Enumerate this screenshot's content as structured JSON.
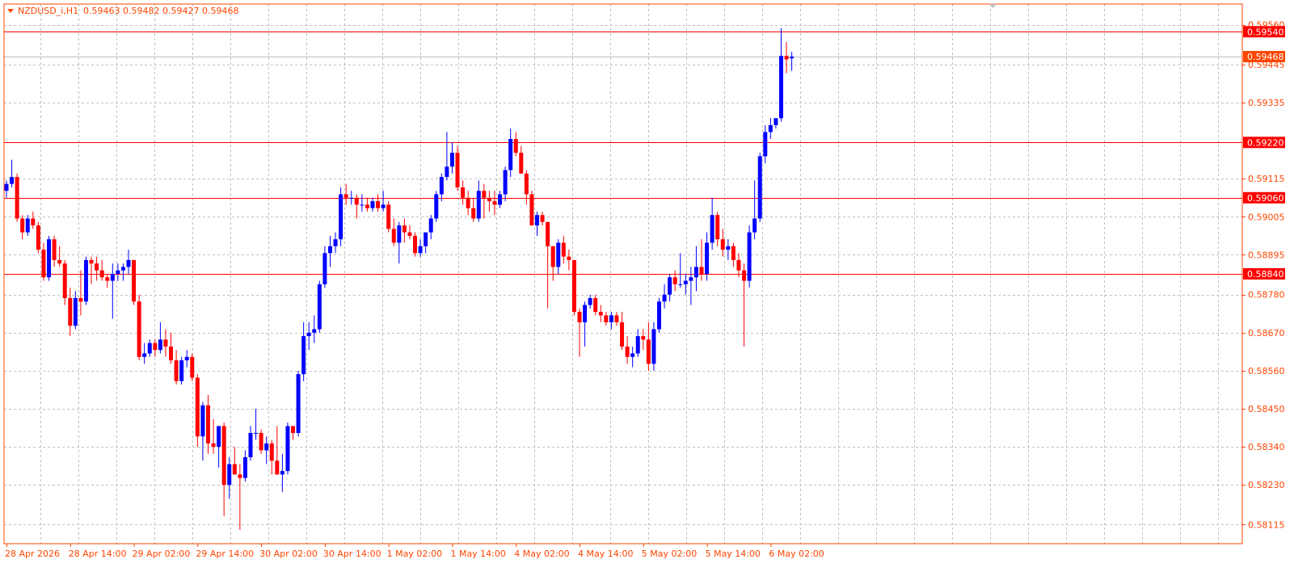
{
  "header": {
    "symbol": "NZDUSD_i,H1",
    "ohlc": "0.59463 0.59482 0.59427 0.59468"
  },
  "colors": {
    "background": "#ffffff",
    "frame": "#ff4500",
    "grid": "#c0c0c0",
    "bull": "#0000ff",
    "bear": "#ff0000",
    "level_line": "#ff0000",
    "bid_line": "#c0c0c0",
    "bid_tag": "#ff4500"
  },
  "chart_data": {
    "type": "candlestick",
    "timeframe": "H1",
    "ylim": [
      0.5806,
      0.5962
    ],
    "grid": true,
    "y_ticks": [
      "0.59560",
      "0.59445",
      "0.59335",
      "0.59115",
      "0.59005",
      "0.58895",
      "0.58780",
      "0.58670",
      "0.58560",
      "0.58450",
      "0.58340",
      "0.58230",
      "0.58115"
    ],
    "y_tick_values": [
      0.5956,
      0.59445,
      0.59335,
      0.59115,
      0.59005,
      0.58895,
      0.5878,
      0.5867,
      0.5856,
      0.5845,
      0.5834,
      0.5823,
      0.58115
    ],
    "x_labels": [
      "28 Apr 2026",
      "28 Apr 14:00",
      "29 Apr 02:00",
      "29 Apr 14:00",
      "30 Apr 02:00",
      "30 Apr 14:00",
      "1 May 02:00",
      "1 May 14:00",
      "4 May 02:00",
      "4 May 14:00",
      "5 May 02:00",
      "5 May 14:00",
      "6 May 02:00"
    ],
    "x_label_bars": [
      0,
      12,
      24,
      36,
      48,
      60,
      72,
      84,
      96,
      108,
      120,
      132,
      144
    ],
    "levels": [
      {
        "label": "0.59540",
        "value": 0.5954
      },
      {
        "label": "0.59220",
        "value": 0.5922
      },
      {
        "label": "0.59060",
        "value": 0.5906
      },
      {
        "label": "0.58840",
        "value": 0.5884
      }
    ],
    "bid": {
      "label": "0.59468",
      "value": 0.59468
    },
    "candles": [
      [
        0.5908,
        0.5911,
        0.5906,
        0.591
      ],
      [
        0.591,
        0.5917,
        0.5909,
        0.5912
      ],
      [
        0.5912,
        0.5913,
        0.5899,
        0.59
      ],
      [
        0.59,
        0.5901,
        0.5894,
        0.5896
      ],
      [
        0.5896,
        0.5901,
        0.5895,
        0.59
      ],
      [
        0.59,
        0.5902,
        0.5897,
        0.5898
      ],
      [
        0.5898,
        0.5899,
        0.589,
        0.5891
      ],
      [
        0.5891,
        0.5893,
        0.5882,
        0.5883
      ],
      [
        0.5883,
        0.5895,
        0.5882,
        0.5894
      ],
      [
        0.5894,
        0.5895,
        0.5886,
        0.5888
      ],
      [
        0.5888,
        0.5892,
        0.5886,
        0.5887
      ],
      [
        0.5887,
        0.5888,
        0.5875,
        0.5877
      ],
      [
        0.5877,
        0.588,
        0.5866,
        0.5869
      ],
      [
        0.5869,
        0.5879,
        0.5868,
        0.5877
      ],
      [
        0.5877,
        0.5885,
        0.5872,
        0.5876
      ],
      [
        0.5876,
        0.5889,
        0.5875,
        0.5888
      ],
      [
        0.5888,
        0.5889,
        0.5881,
        0.5887
      ],
      [
        0.5887,
        0.5889,
        0.5882,
        0.5885
      ],
      [
        0.5885,
        0.5888,
        0.5882,
        0.5883
      ],
      [
        0.5883,
        0.5884,
        0.588,
        0.5882
      ],
      [
        0.5882,
        0.5887,
        0.5871,
        0.5884
      ],
      [
        0.5884,
        0.5887,
        0.5882,
        0.5885
      ],
      [
        0.5885,
        0.5887,
        0.5882,
        0.5886
      ],
      [
        0.5886,
        0.5891,
        0.5884,
        0.5888
      ],
      [
        0.5888,
        0.5888,
        0.5875,
        0.5876
      ],
      [
        0.5876,
        0.5878,
        0.5859,
        0.586
      ],
      [
        0.586,
        0.5864,
        0.5858,
        0.5861
      ],
      [
        0.5861,
        0.5865,
        0.586,
        0.5864
      ],
      [
        0.5864,
        0.5865,
        0.586,
        0.5862
      ],
      [
        0.5862,
        0.587,
        0.5861,
        0.5865
      ],
      [
        0.5865,
        0.5868,
        0.586,
        0.5863
      ],
      [
        0.5863,
        0.5867,
        0.5858,
        0.5859
      ],
      [
        0.5859,
        0.5862,
        0.5852,
        0.5853
      ],
      [
        0.5853,
        0.586,
        0.5852,
        0.5859
      ],
      [
        0.5859,
        0.5862,
        0.5857,
        0.586
      ],
      [
        0.586,
        0.5861,
        0.5853,
        0.5854
      ],
      [
        0.5854,
        0.5855,
        0.5834,
        0.5837
      ],
      [
        0.5837,
        0.5847,
        0.583,
        0.5846
      ],
      [
        0.5846,
        0.5849,
        0.5832,
        0.5835
      ],
      [
        0.5835,
        0.5842,
        0.5832,
        0.5834
      ],
      [
        0.5834,
        0.584,
        0.5828,
        0.584
      ],
      [
        0.584,
        0.5841,
        0.5814,
        0.5823
      ],
      [
        0.5823,
        0.5831,
        0.5819,
        0.5829
      ],
      [
        0.5829,
        0.5834,
        0.5826,
        0.5826
      ],
      [
        0.5826,
        0.5829,
        0.581,
        0.5825
      ],
      [
        0.5825,
        0.5833,
        0.5824,
        0.5831
      ],
      [
        0.5831,
        0.584,
        0.583,
        0.5838
      ],
      [
        0.5838,
        0.5845,
        0.5836,
        0.5838
      ],
      [
        0.5838,
        0.5839,
        0.5832,
        0.5833
      ],
      [
        0.5833,
        0.5837,
        0.5829,
        0.5835
      ],
      [
        0.5835,
        0.5836,
        0.5826,
        0.583
      ],
      [
        0.583,
        0.584,
        0.5826,
        0.5826
      ],
      [
        0.5826,
        0.5832,
        0.5821,
        0.5827
      ],
      [
        0.5827,
        0.5841,
        0.5826,
        0.584
      ],
      [
        0.584,
        0.584,
        0.5836,
        0.5838
      ],
      [
        0.5838,
        0.5856,
        0.5837,
        0.5855
      ],
      [
        0.5855,
        0.587,
        0.5853,
        0.5866
      ],
      [
        0.5866,
        0.587,
        0.5862,
        0.5867
      ],
      [
        0.5867,
        0.5872,
        0.5864,
        0.5868
      ],
      [
        0.5868,
        0.5882,
        0.5867,
        0.5881
      ],
      [
        0.5881,
        0.5892,
        0.588,
        0.589
      ],
      [
        0.589,
        0.5895,
        0.5886,
        0.5892
      ],
      [
        0.5892,
        0.5896,
        0.589,
        0.5894
      ],
      [
        0.5894,
        0.5909,
        0.5892,
        0.5907
      ],
      [
        0.5907,
        0.591,
        0.5904,
        0.5906
      ],
      [
        0.5906,
        0.5908,
        0.5904,
        0.5906
      ],
      [
        0.5906,
        0.5907,
        0.59,
        0.5904
      ],
      [
        0.5904,
        0.5907,
        0.5902,
        0.5904
      ],
      [
        0.5904,
        0.5906,
        0.5902,
        0.5903
      ],
      [
        0.5903,
        0.5906,
        0.5902,
        0.5905
      ],
      [
        0.5905,
        0.5907,
        0.5902,
        0.5903
      ],
      [
        0.5903,
        0.5908,
        0.5902,
        0.5904
      ],
      [
        0.5904,
        0.5905,
        0.5896,
        0.5897
      ],
      [
        0.5897,
        0.59,
        0.5892,
        0.5893
      ],
      [
        0.5893,
        0.5899,
        0.5887,
        0.5898
      ],
      [
        0.5898,
        0.59,
        0.5893,
        0.5896
      ],
      [
        0.5896,
        0.5898,
        0.5894,
        0.5895
      ],
      [
        0.5895,
        0.5896,
        0.5889,
        0.589
      ],
      [
        0.589,
        0.5894,
        0.5889,
        0.5892
      ],
      [
        0.5892,
        0.5895,
        0.589,
        0.5896
      ],
      [
        0.5896,
        0.5901,
        0.5894,
        0.59
      ],
      [
        0.59,
        0.5908,
        0.5899,
        0.5907
      ],
      [
        0.5907,
        0.5913,
        0.5905,
        0.5912
      ],
      [
        0.5912,
        0.5925,
        0.5911,
        0.5915
      ],
      [
        0.5915,
        0.5922,
        0.5913,
        0.5919
      ],
      [
        0.5919,
        0.5921,
        0.5908,
        0.5909
      ],
      [
        0.5909,
        0.5911,
        0.5904,
        0.5906
      ],
      [
        0.5906,
        0.5908,
        0.5901,
        0.5903
      ],
      [
        0.5903,
        0.5906,
        0.5899,
        0.59
      ],
      [
        0.59,
        0.5911,
        0.5899,
        0.5908
      ],
      [
        0.5908,
        0.591,
        0.59,
        0.5906
      ],
      [
        0.5906,
        0.5908,
        0.5902,
        0.5905
      ],
      [
        0.5905,
        0.5908,
        0.5901,
        0.5904
      ],
      [
        0.5904,
        0.5908,
        0.5903,
        0.5907
      ],
      [
        0.5907,
        0.5915,
        0.5905,
        0.5914
      ],
      [
        0.5914,
        0.5926,
        0.5912,
        0.5923
      ],
      [
        0.5923,
        0.5925,
        0.5918,
        0.5919
      ],
      [
        0.5919,
        0.5921,
        0.5913,
        0.5913
      ],
      [
        0.5913,
        0.5914,
        0.5904,
        0.5907
      ],
      [
        0.5907,
        0.5908,
        0.5898,
        0.5898
      ],
      [
        0.5898,
        0.5902,
        0.5895,
        0.5901
      ],
      [
        0.5901,
        0.5902,
        0.5898,
        0.5899
      ],
      [
        0.5899,
        0.5899,
        0.5874,
        0.5892
      ],
      [
        0.5892,
        0.5892,
        0.5882,
        0.5886
      ],
      [
        0.5886,
        0.5894,
        0.5884,
        0.5893
      ],
      [
        0.5893,
        0.5895,
        0.5887,
        0.5889
      ],
      [
        0.5889,
        0.5891,
        0.5885,
        0.5888
      ],
      [
        0.5888,
        0.5888,
        0.5872,
        0.5873
      ],
      [
        0.5873,
        0.5874,
        0.586,
        0.587
      ],
      [
        0.587,
        0.5876,
        0.5863,
        0.5875
      ],
      [
        0.5875,
        0.5878,
        0.5874,
        0.5877
      ],
      [
        0.5877,
        0.5878,
        0.5872,
        0.5873
      ],
      [
        0.5873,
        0.5875,
        0.587,
        0.5872
      ],
      [
        0.5872,
        0.5873,
        0.5869,
        0.587
      ],
      [
        0.587,
        0.5873,
        0.5868,
        0.5872
      ],
      [
        0.5872,
        0.5873,
        0.5869,
        0.587
      ],
      [
        0.587,
        0.5873,
        0.5862,
        0.5863
      ],
      [
        0.5863,
        0.5866,
        0.5858,
        0.586
      ],
      [
        0.586,
        0.5863,
        0.5857,
        0.5861
      ],
      [
        0.5861,
        0.5868,
        0.586,
        0.5866
      ],
      [
        0.5866,
        0.5868,
        0.5862,
        0.5865
      ],
      [
        0.5865,
        0.587,
        0.5856,
        0.5858
      ],
      [
        0.5858,
        0.587,
        0.5856,
        0.5868
      ],
      [
        0.5868,
        0.5877,
        0.5867,
        0.5876
      ],
      [
        0.5876,
        0.5881,
        0.5874,
        0.5878
      ],
      [
        0.5878,
        0.5884,
        0.5876,
        0.5883
      ],
      [
        0.5883,
        0.5885,
        0.5879,
        0.5881
      ],
      [
        0.5881,
        0.589,
        0.588,
        0.5881
      ],
      [
        0.5881,
        0.5884,
        0.5878,
        0.5882
      ],
      [
        0.5882,
        0.5886,
        0.5875,
        0.5883
      ],
      [
        0.5883,
        0.5892,
        0.5879,
        0.5886
      ],
      [
        0.5886,
        0.5894,
        0.5882,
        0.5884
      ],
      [
        0.5884,
        0.5896,
        0.5882,
        0.5893
      ],
      [
        0.5893,
        0.5906,
        0.5891,
        0.5901
      ],
      [
        0.5901,
        0.5902,
        0.5892,
        0.5894
      ],
      [
        0.5894,
        0.5897,
        0.5889,
        0.5891
      ],
      [
        0.5891,
        0.5894,
        0.5888,
        0.5892
      ],
      [
        0.5892,
        0.5893,
        0.5886,
        0.5888
      ],
      [
        0.5888,
        0.589,
        0.5883,
        0.5885
      ],
      [
        0.5885,
        0.5887,
        0.5863,
        0.5882
      ],
      [
        0.5882,
        0.5898,
        0.588,
        0.5896
      ],
      [
        0.5896,
        0.5911,
        0.5894,
        0.59
      ],
      [
        0.59,
        0.5919,
        0.5899,
        0.5918
      ],
      [
        0.5918,
        0.5927,
        0.5916,
        0.5925
      ],
      [
        0.5925,
        0.5929,
        0.5923,
        0.5927
      ],
      [
        0.5927,
        0.5929,
        0.5926,
        0.5929
      ],
      [
        0.5929,
        0.5955,
        0.5928,
        0.5947
      ],
      [
        0.5947,
        0.5951,
        0.5942,
        0.5946
      ],
      [
        0.59463,
        0.59482,
        0.59427,
        0.59468
      ]
    ]
  }
}
